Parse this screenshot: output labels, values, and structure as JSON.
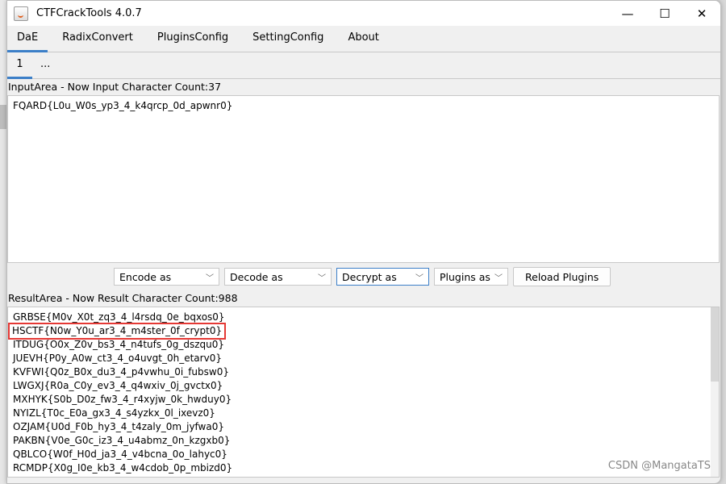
{
  "window": {
    "title": "CTFCrackTools 4.0.7",
    "icon": "java-cup-icon"
  },
  "controls": {
    "minimize": "—",
    "maximize": "☐",
    "close": "✕"
  },
  "tabs": [
    {
      "label": "DaE",
      "active": true
    },
    {
      "label": "RadixConvert"
    },
    {
      "label": "PluginsConfig"
    },
    {
      "label": "SettingConfig"
    },
    {
      "label": "About"
    }
  ],
  "subtabs": [
    {
      "label": "1",
      "active": true
    },
    {
      "label": "..."
    }
  ],
  "input": {
    "label": "InputArea - Now Input Character Count:37",
    "value": "FQARD{L0u_W0s_yp3_4_k4qrcp_0d_apwnr0}"
  },
  "toolbar": {
    "encode": "Encode as",
    "decode": "Decode as",
    "decrypt": "Decrypt as",
    "plugins": "Plugins as",
    "reload": "Reload Plugins"
  },
  "result": {
    "label": "ResultArea - Now Result Character Count:988",
    "lines": [
      "GRBSE{M0v_X0t_zq3_4_l4rsdq_0e_bqxos0}",
      "HSCTF{N0w_Y0u_ar3_4_m4ster_0f_crypt0}",
      "ITDUG{O0x_Z0v_bs3_4_n4tufs_0g_dszqu0}",
      "JUEVH{P0y_A0w_ct3_4_o4uvgt_0h_etarv0}",
      "KVFWI{Q0z_B0x_du3_4_p4vwhu_0i_fubsw0}",
      "LWGXJ{R0a_C0y_ev3_4_q4wxiv_0j_gvctx0}",
      "MXHYK{S0b_D0z_fw3_4_r4xyjw_0k_hwduy0}",
      "NYIZL{T0c_E0a_gx3_4_s4yzkx_0l_ixevz0}",
      "OZJAM{U0d_F0b_hy3_4_t4zaly_0m_jyfwa0}",
      "PAKBN{V0e_G0c_iz3_4_u4abmz_0n_kzgxb0}",
      "QBLCO{W0f_H0d_ja3_4_v4bcna_0o_lahyc0}",
      "RCMDP{X0g_I0e_kb3_4_w4cdob_0p_mbizd0}"
    ],
    "highlighted_index": 1,
    "highlight_color": "#e53935"
  },
  "watermark": "CSDN @MangataTS",
  "colors": {
    "accent": "#3c7fc8"
  }
}
